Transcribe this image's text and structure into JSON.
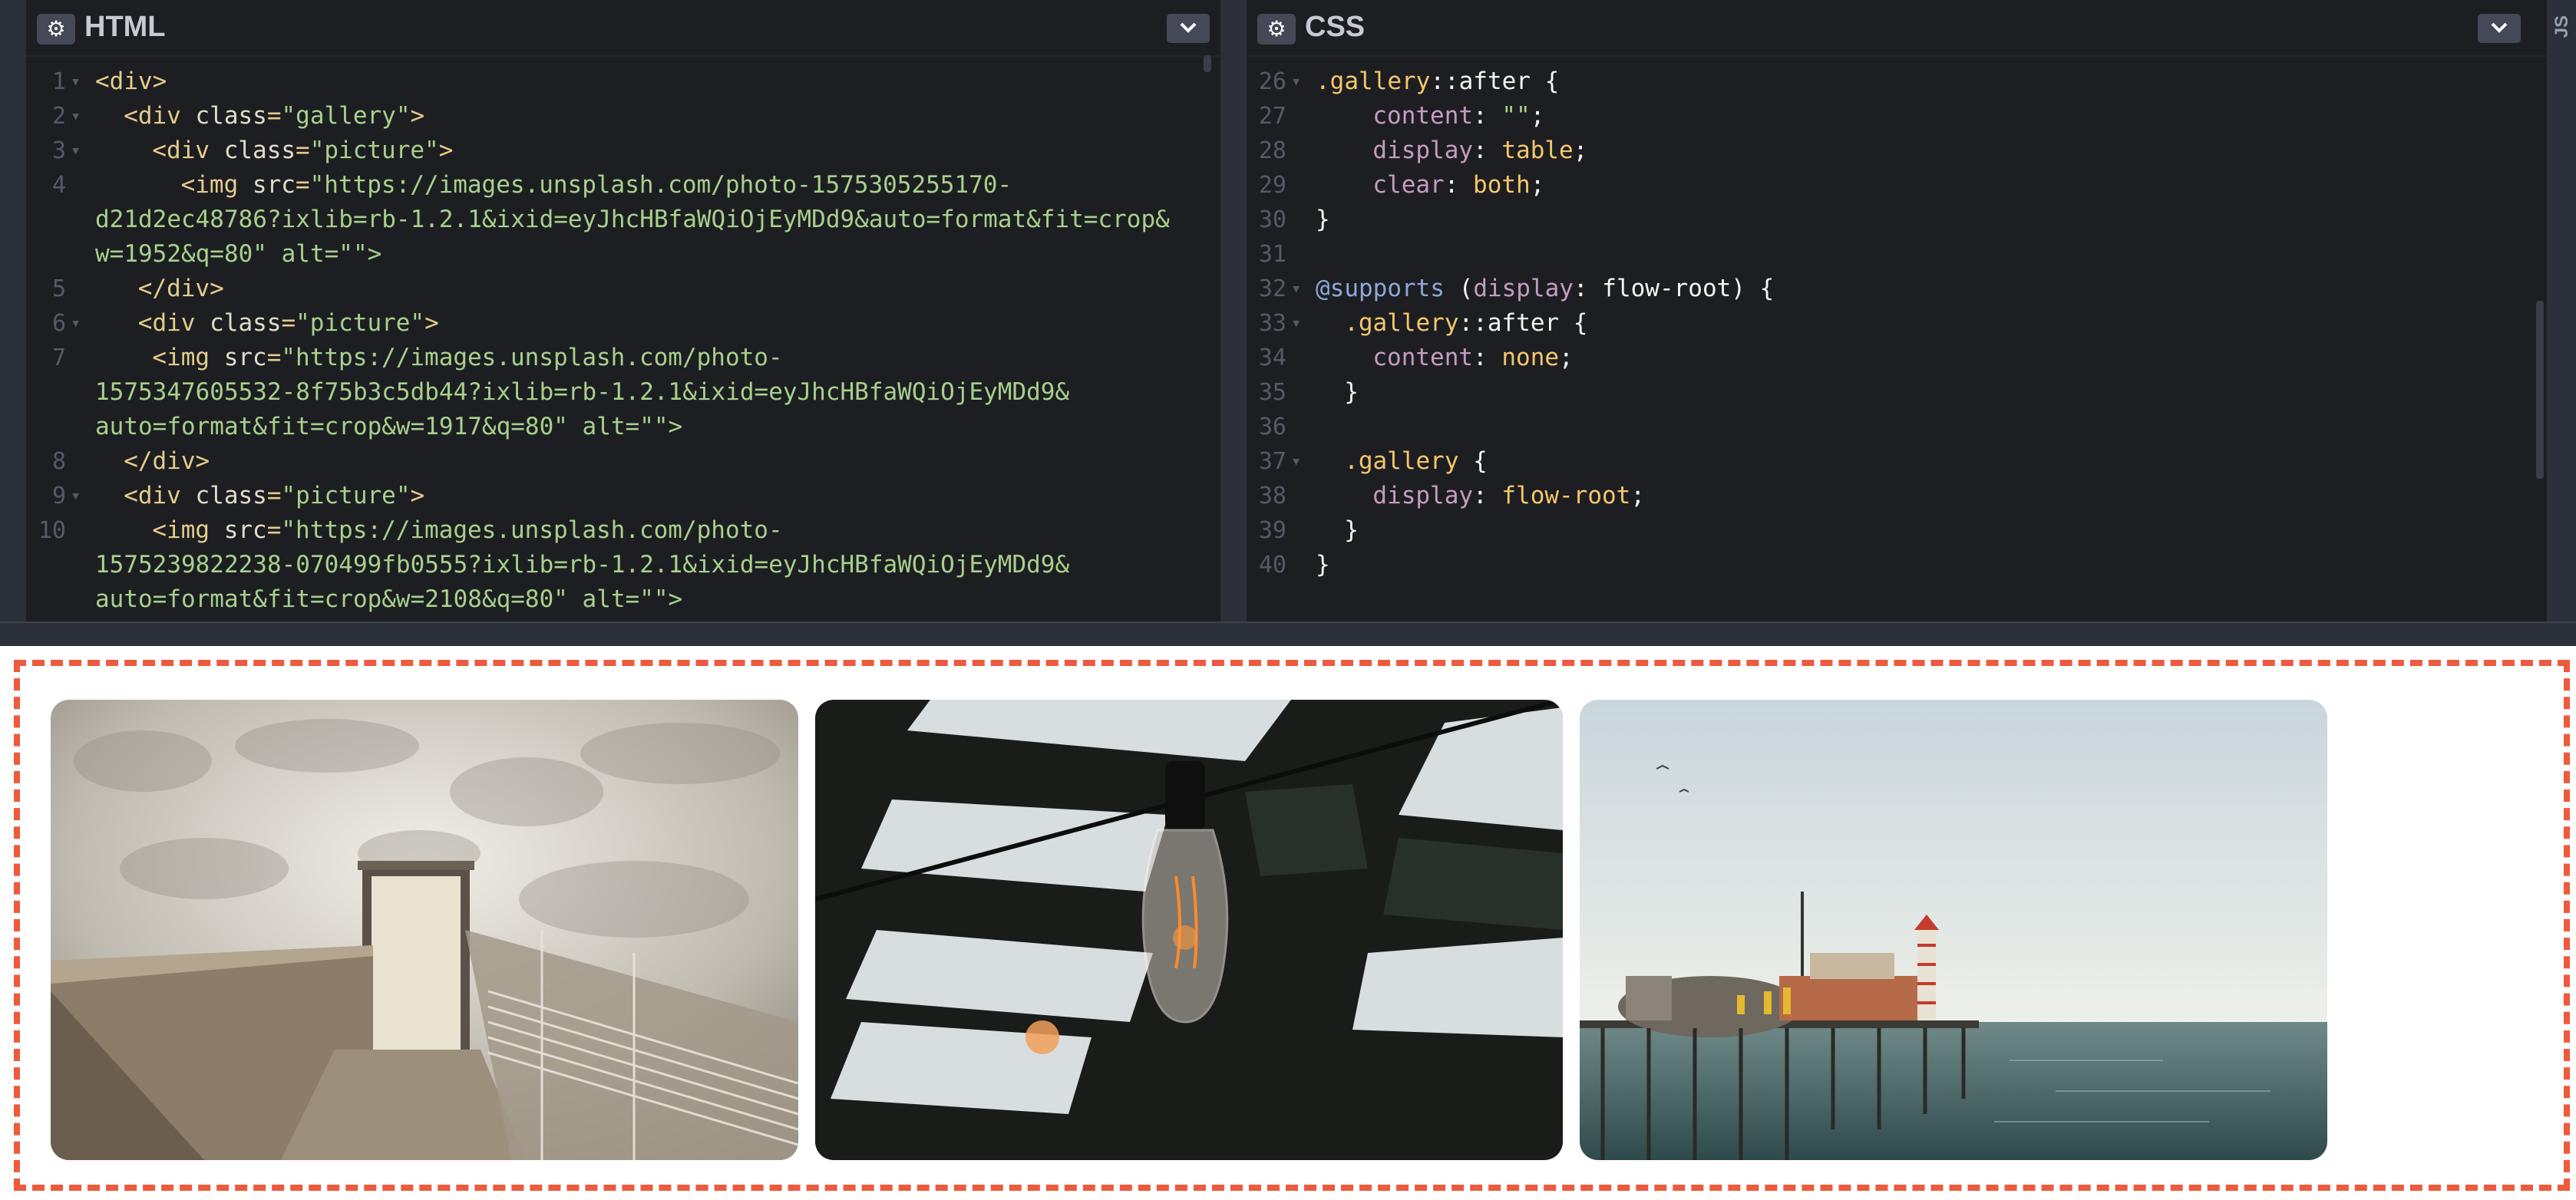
{
  "html_panel": {
    "title": "HTML",
    "lines": [
      {
        "n": "1",
        "fold": true,
        "indent": 0,
        "parts": [
          {
            "c": "t-tag",
            "t": "<div>"
          }
        ]
      },
      {
        "n": "2",
        "fold": true,
        "indent": 2,
        "parts": [
          {
            "c": "t-tag",
            "t": "<div "
          },
          {
            "c": "t-attr",
            "t": "class"
          },
          {
            "c": "t-tag",
            "t": "="
          },
          {
            "c": "t-str",
            "t": "\"gallery\""
          },
          {
            "c": "t-tag",
            "t": ">"
          }
        ]
      },
      {
        "n": "3",
        "fold": true,
        "indent": 4,
        "parts": [
          {
            "c": "t-tag",
            "t": "<div "
          },
          {
            "c": "t-attr",
            "t": "class"
          },
          {
            "c": "t-tag",
            "t": "="
          },
          {
            "c": "t-str",
            "t": "\"picture\""
          },
          {
            "c": "t-tag",
            "t": ">"
          }
        ]
      },
      {
        "n": "4",
        "fold": false,
        "indent": 6,
        "parts": [
          {
            "c": "t-tag",
            "t": "<img "
          },
          {
            "c": "t-attr",
            "t": "src"
          },
          {
            "c": "t-tag",
            "t": "="
          },
          {
            "c": "t-str",
            "t": "\"https://images.unsplash.com/photo-1575305255170-"
          }
        ]
      },
      {
        "cont": "d21d2ec48786?ixlib=rb-1.2.1&ixid=eyJhcHBfaWQiOjEyMDd9&auto=format&fit=crop&"
      },
      {
        "cont": "w=1952&q=80\" alt=\"\">"
      },
      {
        "n": "5",
        "fold": false,
        "indent": 3,
        "parts": [
          {
            "c": "t-tag",
            "t": "</div>"
          }
        ]
      },
      {
        "n": "6",
        "fold": true,
        "indent": 3,
        "parts": [
          {
            "c": "t-tag",
            "t": "<div "
          },
          {
            "c": "t-attr",
            "t": "class"
          },
          {
            "c": "t-tag",
            "t": "="
          },
          {
            "c": "t-str",
            "t": "\"picture\""
          },
          {
            "c": "t-tag",
            "t": ">"
          }
        ]
      },
      {
        "n": "7",
        "fold": false,
        "indent": 4,
        "parts": [
          {
            "c": "t-tag",
            "t": "<img "
          },
          {
            "c": "t-attr",
            "t": "src"
          },
          {
            "c": "t-tag",
            "t": "="
          },
          {
            "c": "t-str",
            "t": "\"https://images.unsplash.com/photo-"
          }
        ]
      },
      {
        "cont": "1575347605532-8f75b3c5db44?ixlib=rb-1.2.1&ixid=eyJhcHBfaWQiOjEyMDd9&"
      },
      {
        "cont": "auto=format&fit=crop&w=1917&q=80\" alt=\"\">"
      },
      {
        "n": "8",
        "fold": false,
        "indent": 2,
        "parts": [
          {
            "c": "t-tag",
            "t": "</div>"
          }
        ]
      },
      {
        "n": "9",
        "fold": true,
        "indent": 2,
        "parts": [
          {
            "c": "t-tag",
            "t": "<div "
          },
          {
            "c": "t-attr",
            "t": "class"
          },
          {
            "c": "t-tag",
            "t": "="
          },
          {
            "c": "t-str",
            "t": "\"picture\""
          },
          {
            "c": "t-tag",
            "t": ">"
          }
        ]
      },
      {
        "n": "10",
        "fold": false,
        "indent": 4,
        "parts": [
          {
            "c": "t-tag",
            "t": "<img "
          },
          {
            "c": "t-attr",
            "t": "src"
          },
          {
            "c": "t-tag",
            "t": "="
          },
          {
            "c": "t-str",
            "t": "\"https://images.unsplash.com/photo-"
          }
        ]
      },
      {
        "cont": "1575239822238-070499fb0555?ixlib=rb-1.2.1&ixid=eyJhcHBfaWQiOjEyMDd9&"
      },
      {
        "cont": "auto=format&fit=crop&w=2108&q=80\" alt=\"\">"
      }
    ]
  },
  "css_panel": {
    "title": "CSS",
    "lines": [
      {
        "n": "26",
        "fold": true,
        "indent": 0,
        "parts": [
          {
            "c": "t-sel",
            "t": ".gallery"
          },
          {
            "c": "t-pseudo",
            "t": "::after {"
          }
        ]
      },
      {
        "n": "27",
        "fold": false,
        "indent": 4,
        "parts": [
          {
            "c": "t-prop",
            "t": "content"
          },
          {
            "c": "t-plain",
            "t": ": "
          },
          {
            "c": "t-str",
            "t": "\"\""
          },
          {
            "c": "t-plain",
            "t": ";"
          }
        ]
      },
      {
        "n": "28",
        "fold": false,
        "indent": 4,
        "parts": [
          {
            "c": "t-prop",
            "t": "display"
          },
          {
            "c": "t-plain",
            "t": ": "
          },
          {
            "c": "t-val",
            "t": "table"
          },
          {
            "c": "t-plain",
            "t": ";"
          }
        ]
      },
      {
        "n": "29",
        "fold": false,
        "indent": 4,
        "parts": [
          {
            "c": "t-prop",
            "t": "clear"
          },
          {
            "c": "t-plain",
            "t": ": "
          },
          {
            "c": "t-val",
            "t": "both"
          },
          {
            "c": "t-plain",
            "t": ";"
          }
        ]
      },
      {
        "n": "30",
        "fold": false,
        "indent": 0,
        "parts": [
          {
            "c": "t-plain",
            "t": "}"
          }
        ]
      },
      {
        "n": "31",
        "fold": false,
        "indent": 0,
        "parts": []
      },
      {
        "n": "32",
        "fold": true,
        "indent": 0,
        "parts": [
          {
            "c": "t-at",
            "t": "@supports"
          },
          {
            "c": "t-plain",
            "t": " ("
          },
          {
            "c": "t-prop",
            "t": "display"
          },
          {
            "c": "t-plain",
            "t": ": flow-root) {"
          }
        ]
      },
      {
        "n": "33",
        "fold": true,
        "indent": 2,
        "parts": [
          {
            "c": "t-sel",
            "t": ".gallery"
          },
          {
            "c": "t-pseudo",
            "t": "::after {"
          }
        ]
      },
      {
        "n": "34",
        "fold": false,
        "indent": 4,
        "parts": [
          {
            "c": "t-prop",
            "t": "content"
          },
          {
            "c": "t-plain",
            "t": ": "
          },
          {
            "c": "t-val",
            "t": "none"
          },
          {
            "c": "t-plain",
            "t": ";"
          }
        ]
      },
      {
        "n": "35",
        "fold": false,
        "indent": 2,
        "parts": [
          {
            "c": "t-plain",
            "t": "}"
          }
        ]
      },
      {
        "n": "36",
        "fold": false,
        "indent": 0,
        "parts": []
      },
      {
        "n": "37",
        "fold": true,
        "indent": 2,
        "parts": [
          {
            "c": "t-sel",
            "t": ".gallery"
          },
          {
            "c": "t-plain",
            "t": " {"
          }
        ]
      },
      {
        "n": "38",
        "fold": false,
        "indent": 4,
        "parts": [
          {
            "c": "t-prop",
            "t": "display"
          },
          {
            "c": "t-plain",
            "t": ": "
          },
          {
            "c": "t-val",
            "t": "flow-root"
          },
          {
            "c": "t-plain",
            "t": ";"
          }
        ]
      },
      {
        "n": "39",
        "fold": false,
        "indent": 2,
        "parts": [
          {
            "c": "t-plain",
            "t": "}"
          }
        ]
      },
      {
        "n": "40",
        "fold": false,
        "indent": 0,
        "parts": [
          {
            "c": "t-plain",
            "t": "}"
          }
        ]
      }
    ]
  },
  "js_tab": {
    "label": "JS"
  },
  "icons": {
    "settings": "gear-icon",
    "collapse": "chevron-down-icon"
  },
  "preview": {
    "border_color": "#ee5a3c",
    "pictures": [
      {
        "name": "concrete-stairway-photo"
      },
      {
        "name": "light-bulb-photo"
      },
      {
        "name": "pier-seascape-photo"
      }
    ]
  }
}
